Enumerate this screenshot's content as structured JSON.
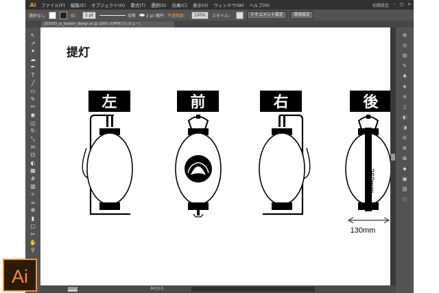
{
  "app": {
    "logo": "Ai",
    "menus": [
      "ファイル(F)",
      "編集(E)",
      "オブジェクト(O)",
      "書式(T)",
      "選択(S)",
      "効果(C)",
      "表示(V)",
      "ウィンドウ(W)",
      "ヘルプ(H)"
    ],
    "workspace": "初期設定",
    "window_buttons": [
      "–",
      "□",
      "×"
    ]
  },
  "control_bar": {
    "selection": "選択なし",
    "stroke_label": "線：",
    "stroke_weight": "1 pt",
    "brush_label": "均等",
    "profile_label": "2 pt 楕円",
    "opacity_label": "不透明度：",
    "opacity_value": "100%",
    "style_label": "スタイル：",
    "doc_settings": "ドキュメント設定",
    "env_settings": "環境設定"
  },
  "document_tab": {
    "title": "202003_ai_lantern_design.ai @ 100% (CMYK/プレビュー)"
  },
  "tools": [
    "selection-tool",
    "direct-selection-tool",
    "magic-wand-tool",
    "lasso-tool",
    "pen-tool",
    "type-tool",
    "line-tool",
    "rectangle-tool",
    "paintbrush-tool",
    "pencil-tool",
    "blob-brush-tool",
    "eraser-tool",
    "rotate-tool",
    "scale-tool",
    "width-tool",
    "free-transform-tool",
    "shape-builder-tool",
    "perspective-grid-tool",
    "mesh-tool",
    "gradient-tool",
    "eyedropper-tool",
    "blend-tool",
    "symbol-sprayer-tool",
    "column-graph-tool",
    "artboard-tool",
    "slice-tool",
    "hand-tool",
    "zoom-tool"
  ],
  "panel_icons": [
    "color-panel-icon",
    "color-guide-icon",
    "swatches-icon",
    "brushes-icon",
    "symbols-icon",
    "graphic-styles-icon",
    "stroke-icon",
    "gradient-icon",
    "transparency-icon",
    "appearance-icon",
    "align-icon",
    "pathfinder-icon",
    "transform-icon",
    "layers-icon",
    "artboards-icon",
    "links-icon",
    "info-icon"
  ],
  "artwork": {
    "title": "提灯",
    "labels": [
      "左",
      "前",
      "右",
      "後"
    ],
    "height_dim": "260mm",
    "width_dim": "130mm"
  },
  "status_bar": {
    "zoom": "100%",
    "tool": "手のひら"
  },
  "ai_badge": "Ai"
}
